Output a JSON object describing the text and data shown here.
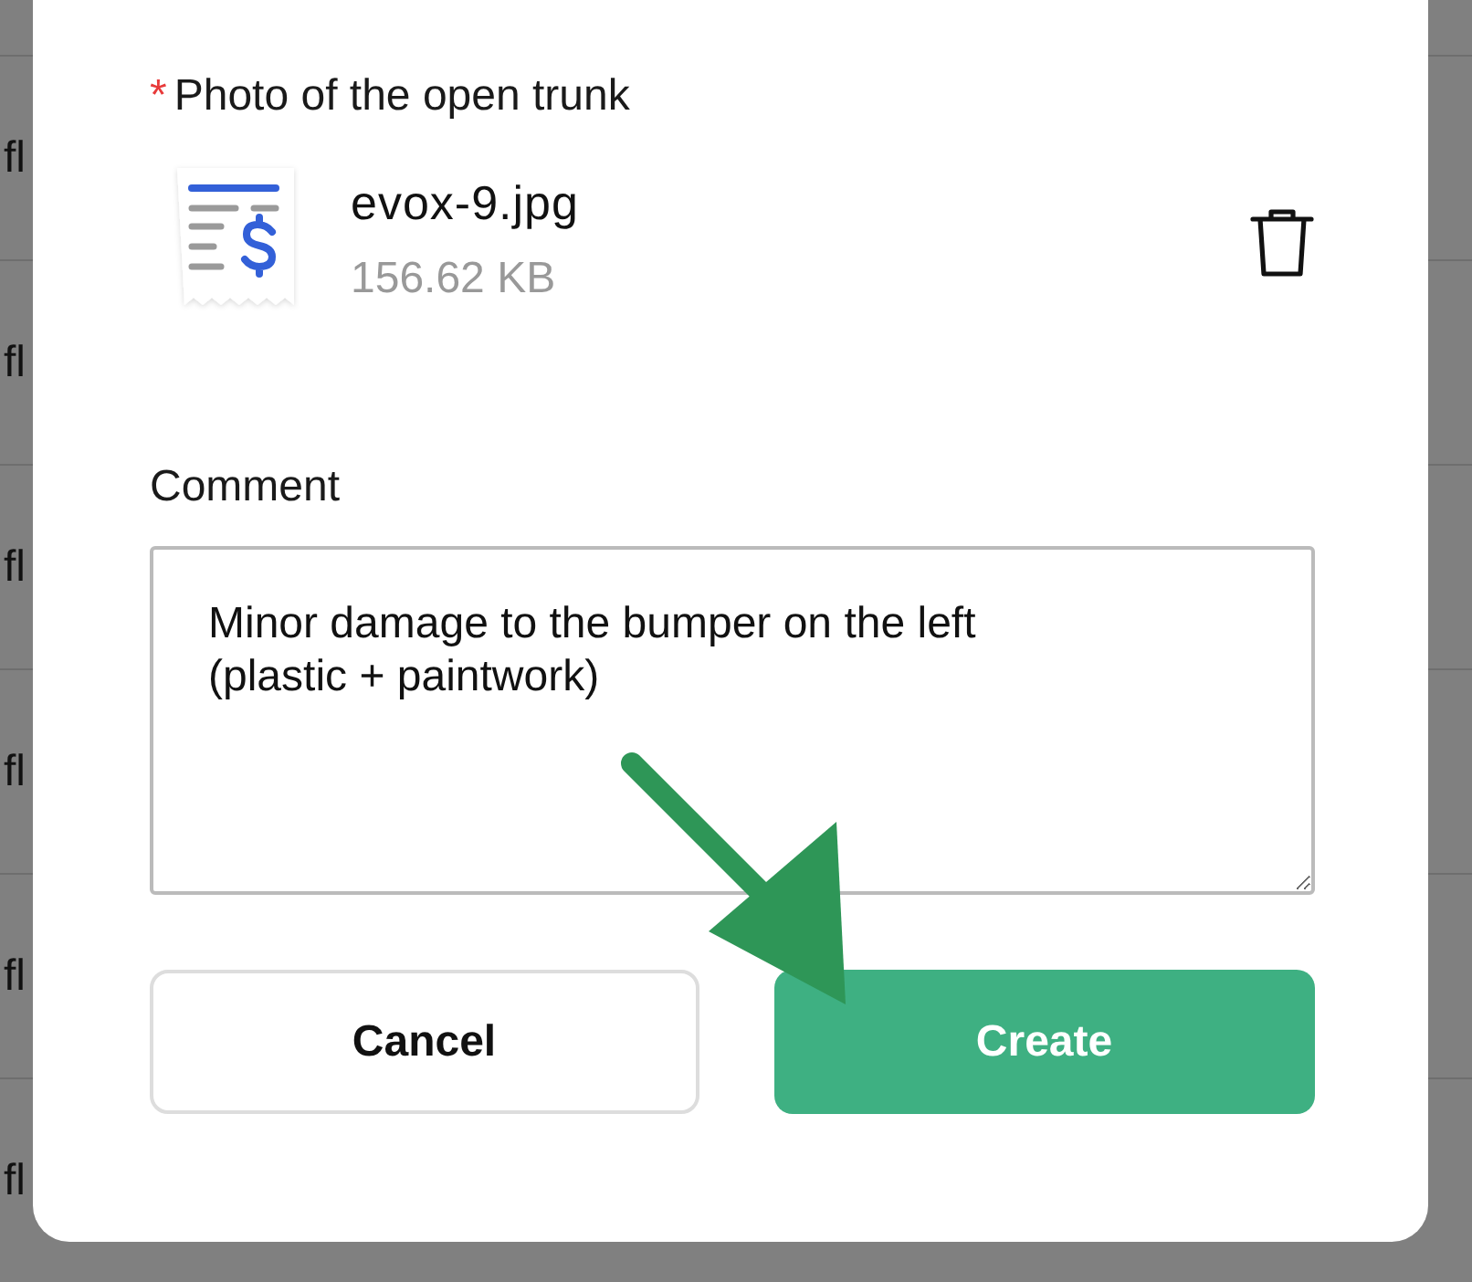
{
  "background_rows": [
    {
      "text": "fl"
    },
    {
      "text": "fl"
    },
    {
      "text": "fl"
    },
    {
      "text": "fl"
    },
    {
      "text": "fl"
    },
    {
      "text": "fl"
    }
  ],
  "dialog": {
    "photo_field": {
      "label": "Photo of the open trunk",
      "required_mark": "*",
      "file": {
        "name": "evox-9.jpg",
        "size": "156.62 KB"
      }
    },
    "comment": {
      "label": "Comment",
      "value": "Minor damage to the bumper on the left\n(plastic + paintwork)"
    },
    "buttons": [
      {
        "label": "Cancel",
        "kind": "secondary"
      },
      {
        "label": "Create",
        "kind": "primary"
      }
    ]
  }
}
